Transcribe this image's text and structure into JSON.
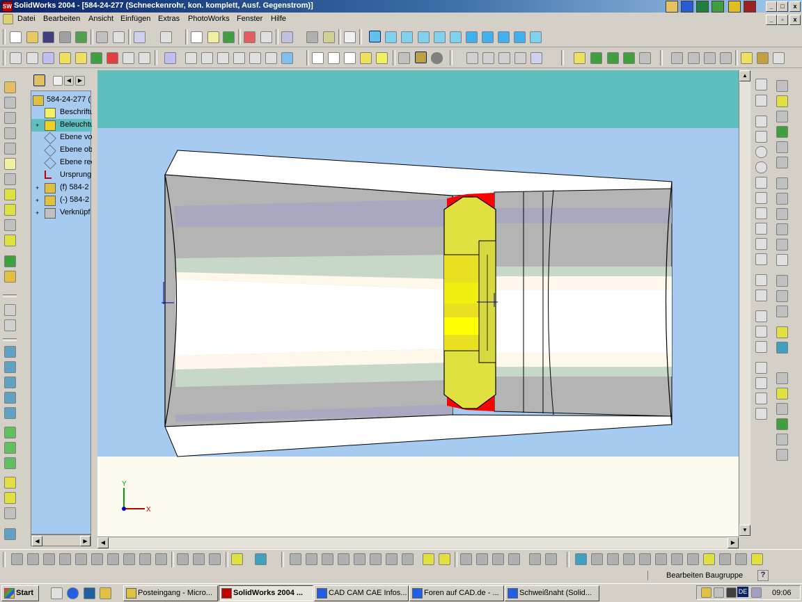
{
  "window": {
    "title": "SolidWorks 2004 - [584-24-277 (Schneckenrohr, kon. komplett, Ausf. Gegenstrom)]",
    "logo": "SW",
    "min": "_",
    "max": "□",
    "close": "x"
  },
  "menu": [
    "Datei",
    "Bearbeiten",
    "Ansicht",
    "Einfügen",
    "Extras",
    "PhotoWorks",
    "Fenster",
    "Hilfe"
  ],
  "tree": {
    "items": [
      {
        "label": "584-24-277 (",
        "icon": "assembly-icon"
      },
      {
        "label": "Beschriftungen",
        "icon": "annotations-icon"
      },
      {
        "label": "Beleuchtung",
        "icon": "lighting-icon"
      },
      {
        "label": "Ebene vorne",
        "icon": "plane-icon"
      },
      {
        "label": "Ebene oben",
        "icon": "plane-icon"
      },
      {
        "label": "Ebene rechts",
        "icon": "plane-icon"
      },
      {
        "label": "Ursprung",
        "icon": "origin-icon"
      },
      {
        "label": "(f) 584-2",
        "icon": "part-icon"
      },
      {
        "label": "(-) 584-2",
        "icon": "part-icon"
      },
      {
        "label": "Verknüpf",
        "icon": "mates-icon"
      }
    ]
  },
  "axes": {
    "y": "Y",
    "x": "X"
  },
  "status": {
    "mode": "Bearbeiten Baugruppe",
    "help": "?"
  },
  "taskbar": {
    "start": "Start",
    "tasks": [
      "Posteingang - Micro...",
      "SolidWorks 2004 ...",
      "CAD CAM CAE Infos...",
      "Foren auf CAD.de - ...",
      "Schweißnaht (Solid..."
    ],
    "lang": "DE",
    "clock": "09:06"
  },
  "colors": {
    "background": "#a6caf0",
    "top_band": "#5fbfbf",
    "bottom_band": "#fcf9ee",
    "weld": "#e8e020",
    "weld_red": "#ff0000",
    "pipe_grey": "#b4b4b4"
  }
}
